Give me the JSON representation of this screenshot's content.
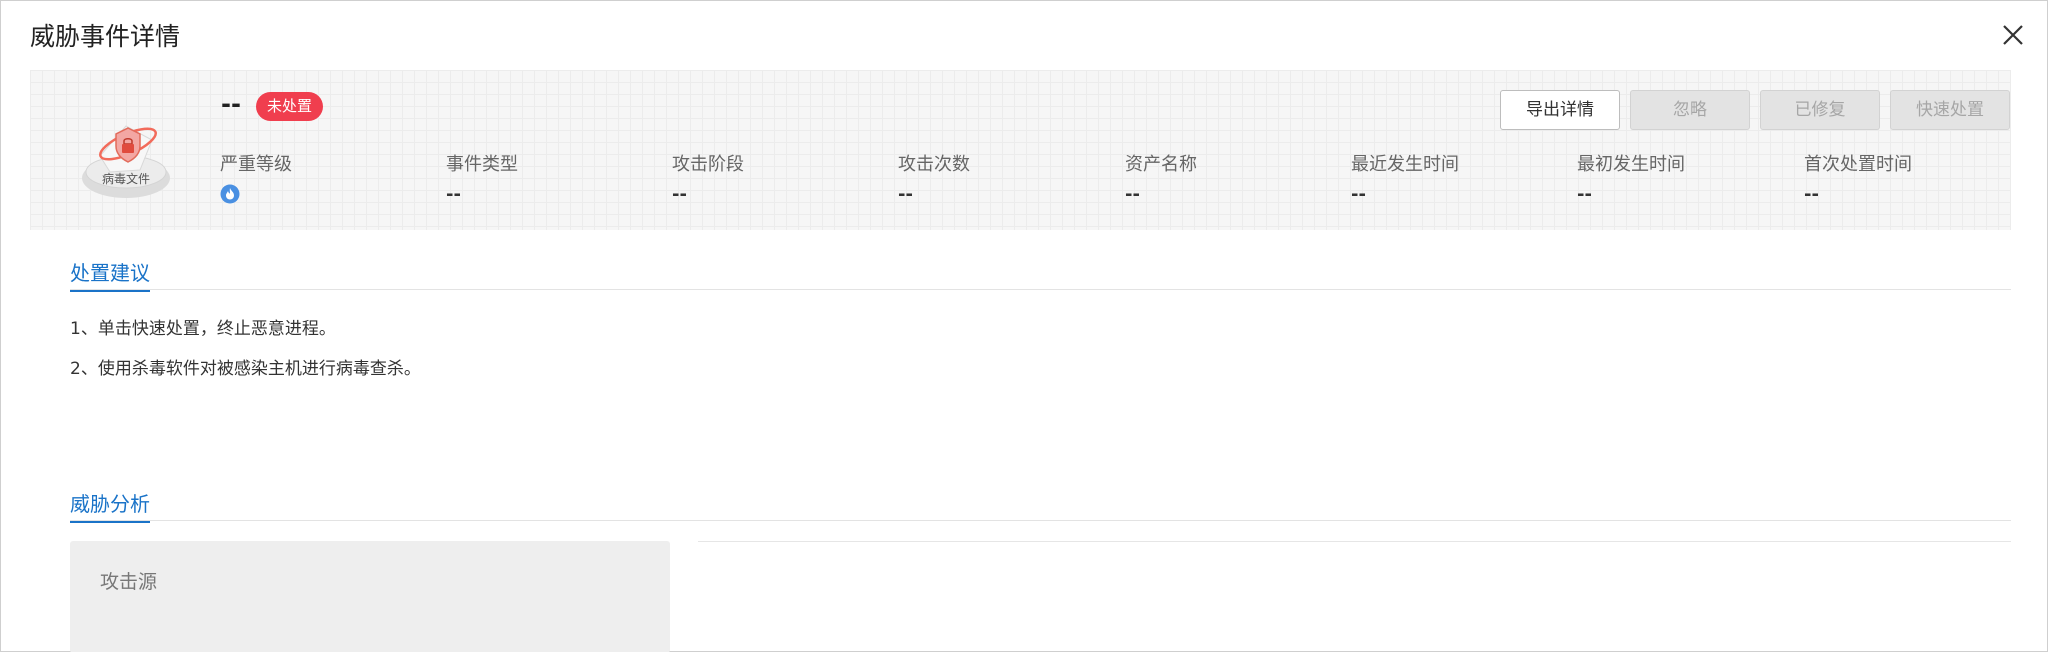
{
  "dialog": {
    "title": "威胁事件详情"
  },
  "event": {
    "name": "--",
    "status": "未处置"
  },
  "actions": {
    "export": "导出详情",
    "ignore": "忽略",
    "repaired": "已修复",
    "quick_handle": "快速处置"
  },
  "icon": {
    "label": "病毒文件",
    "name": "virus-file-icon"
  },
  "fields": [
    {
      "label": "严重等级",
      "value": ""
    },
    {
      "label": "事件类型",
      "value": "--"
    },
    {
      "label": "攻击阶段",
      "value": "--"
    },
    {
      "label": "攻击次数",
      "value": "--"
    },
    {
      "label": "资产名称",
      "value": "--"
    },
    {
      "label": "最近发生时间",
      "value": "--"
    },
    {
      "label": "最初发生时间",
      "value": "--"
    },
    {
      "label": "首次处置时间",
      "value": "--"
    }
  ],
  "advice_section": {
    "title": "处置建议",
    "items": [
      "1、单击快速处置，终止恶意进程。",
      "2、使用杀毒软件对被感染主机进行病毒查杀。"
    ]
  },
  "analysis_section": {
    "title": "威胁分析",
    "source_title": "攻击源"
  },
  "colors": {
    "accent": "#1a73c8",
    "status": "#f03e4e",
    "severity": "#4a90e2"
  }
}
